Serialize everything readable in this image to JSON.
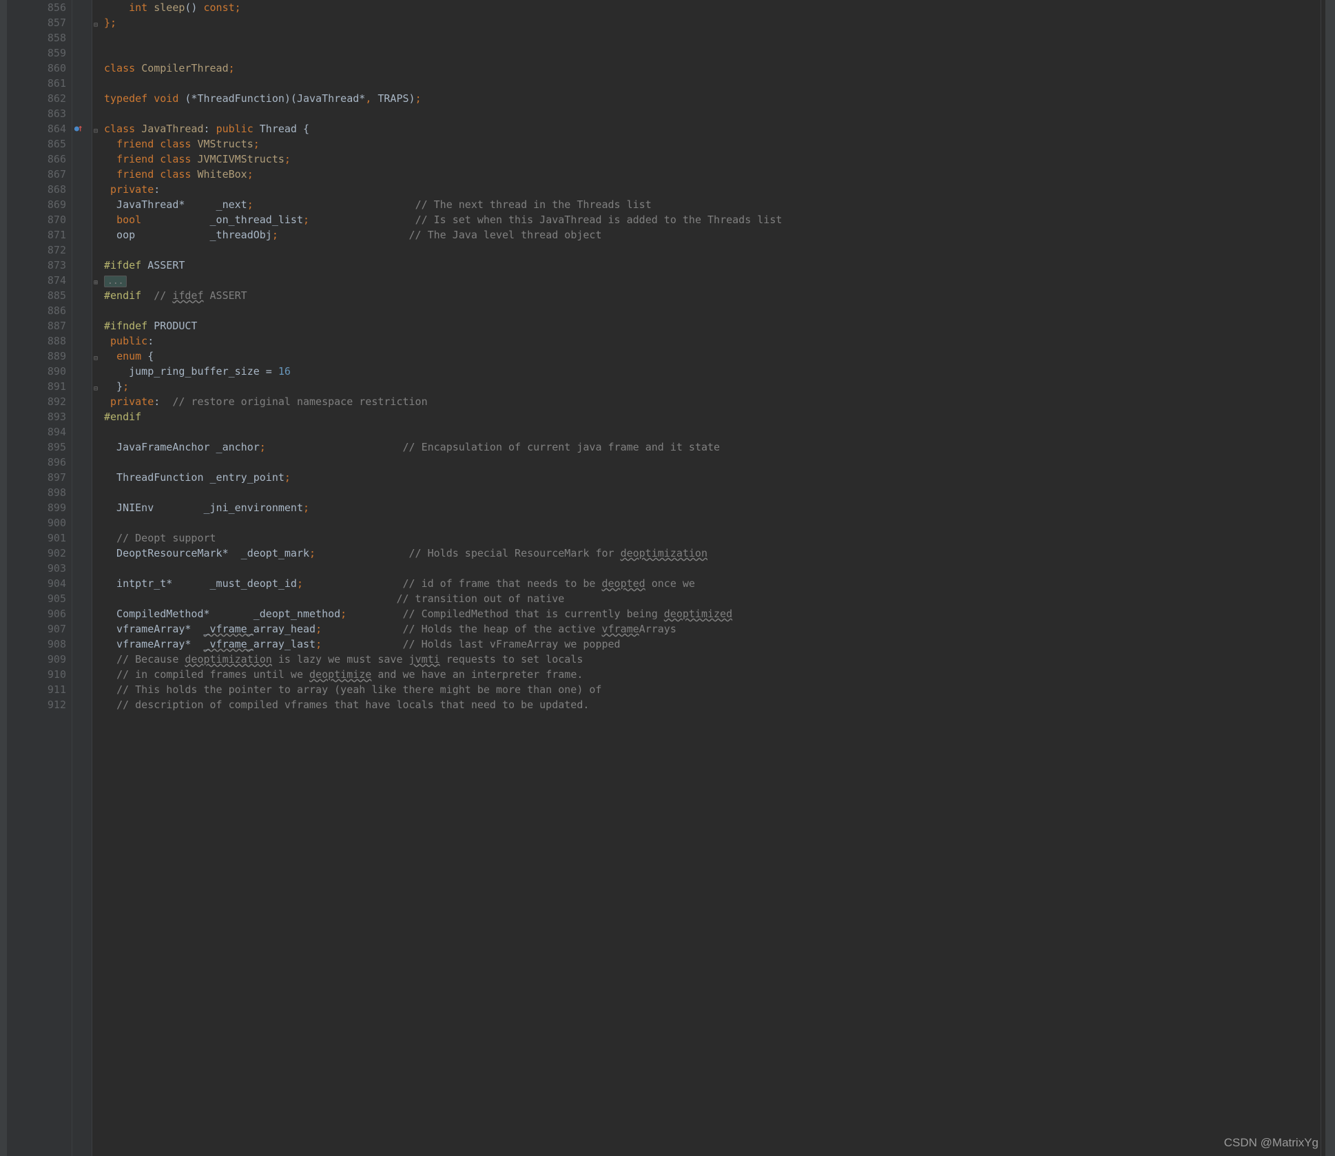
{
  "watermark": "CSDN @MatrixYg",
  "lines": [
    {
      "n": "856",
      "tokens": [
        {
          "t": "    ",
          "c": ""
        },
        {
          "t": "int",
          "c": "kw"
        },
        {
          "t": " ",
          "c": ""
        },
        {
          "t": "sleep",
          "c": "type"
        },
        {
          "t": "() ",
          "c": ""
        },
        {
          "t": "const",
          "c": "kw"
        },
        {
          "t": ";",
          "c": "kw"
        }
      ]
    },
    {
      "n": "857",
      "tokens": [
        {
          "t": "};",
          "c": "kw"
        }
      ],
      "fold": "⊟"
    },
    {
      "n": "858",
      "tokens": []
    },
    {
      "n": "859",
      "tokens": []
    },
    {
      "n": "860",
      "tokens": [
        {
          "t": "class",
          "c": "kw"
        },
        {
          "t": " ",
          "c": ""
        },
        {
          "t": "CompilerThread",
          "c": "type"
        },
        {
          "t": ";",
          "c": "kw"
        }
      ]
    },
    {
      "n": "861",
      "tokens": []
    },
    {
      "n": "862",
      "tokens": [
        {
          "t": "typedef",
          "c": "kw"
        },
        {
          "t": " ",
          "c": ""
        },
        {
          "t": "void",
          "c": "kw"
        },
        {
          "t": " (*ThreadFunction)(JavaThread*",
          "c": ""
        },
        {
          "t": ",",
          "c": "kw"
        },
        {
          "t": " TRAPS)",
          "c": ""
        },
        {
          "t": ";",
          "c": "kw"
        }
      ]
    },
    {
      "n": "863",
      "tokens": []
    },
    {
      "n": "864",
      "tokens": [
        {
          "t": "class",
          "c": "kw"
        },
        {
          "t": " ",
          "c": ""
        },
        {
          "t": "JavaThread",
          "c": "type"
        },
        {
          "t": ": ",
          "c": ""
        },
        {
          "t": "public",
          "c": "kw"
        },
        {
          "t": " Thread {",
          "c": ""
        }
      ],
      "fold": "⊟",
      "marker": "override"
    },
    {
      "n": "865",
      "tokens": [
        {
          "t": "  ",
          "c": ""
        },
        {
          "t": "friend",
          "c": "kw"
        },
        {
          "t": " ",
          "c": ""
        },
        {
          "t": "class",
          "c": "kw"
        },
        {
          "t": " ",
          "c": ""
        },
        {
          "t": "VMStructs",
          "c": "type"
        },
        {
          "t": ";",
          "c": "kw"
        }
      ]
    },
    {
      "n": "866",
      "tokens": [
        {
          "t": "  ",
          "c": ""
        },
        {
          "t": "friend",
          "c": "kw"
        },
        {
          "t": " ",
          "c": ""
        },
        {
          "t": "class",
          "c": "kw"
        },
        {
          "t": " ",
          "c": ""
        },
        {
          "t": "JVMCIVMStructs",
          "c": "type"
        },
        {
          "t": ";",
          "c": "kw"
        }
      ]
    },
    {
      "n": "867",
      "tokens": [
        {
          "t": "  ",
          "c": ""
        },
        {
          "t": "friend",
          "c": "kw"
        },
        {
          "t": " ",
          "c": ""
        },
        {
          "t": "class",
          "c": "kw"
        },
        {
          "t": " ",
          "c": ""
        },
        {
          "t": "WhiteBox",
          "c": "type"
        },
        {
          "t": ";",
          "c": "kw"
        }
      ]
    },
    {
      "n": "868",
      "tokens": [
        {
          "t": " ",
          "c": ""
        },
        {
          "t": "private",
          "c": "kw"
        },
        {
          "t": ":",
          "c": ""
        }
      ]
    },
    {
      "n": "869",
      "tokens": [
        {
          "t": "  JavaThread*     _next",
          "c": ""
        },
        {
          "t": ";",
          "c": "kw"
        },
        {
          "t": "                          ",
          "c": ""
        },
        {
          "t": "// The next thread in the Threads list",
          "c": "comment"
        }
      ]
    },
    {
      "n": "870",
      "tokens": [
        {
          "t": "  ",
          "c": ""
        },
        {
          "t": "bool",
          "c": "kw"
        },
        {
          "t": "           _on_thread_list",
          "c": ""
        },
        {
          "t": ";",
          "c": "kw"
        },
        {
          "t": "                 ",
          "c": ""
        },
        {
          "t": "// Is set when this JavaThread is added to the Threads list",
          "c": "comment"
        }
      ]
    },
    {
      "n": "871",
      "tokens": [
        {
          "t": "  oop            _threadObj",
          "c": ""
        },
        {
          "t": ";",
          "c": "kw"
        },
        {
          "t": "                     ",
          "c": ""
        },
        {
          "t": "// The Java level thread object",
          "c": "comment"
        }
      ]
    },
    {
      "n": "872",
      "tokens": []
    },
    {
      "n": "873",
      "tokens": [
        {
          "t": "#ifdef",
          "c": "preproc"
        },
        {
          "t": " ASSERT",
          "c": ""
        }
      ]
    },
    {
      "n": "874",
      "folded": "...",
      "fold": "⊞"
    },
    {
      "n": "885",
      "tokens": [
        {
          "t": "#endif",
          "c": "preproc"
        },
        {
          "t": "  ",
          "c": ""
        },
        {
          "t": "// ",
          "c": "comment"
        },
        {
          "t": "ifdef",
          "c": "comment underline"
        },
        {
          "t": " ASSERT",
          "c": "comment"
        }
      ]
    },
    {
      "n": "886",
      "tokens": []
    },
    {
      "n": "887",
      "tokens": [
        {
          "t": "#ifndef",
          "c": "preproc"
        },
        {
          "t": " PRODUCT",
          "c": ""
        }
      ]
    },
    {
      "n": "888",
      "tokens": [
        {
          "t": " ",
          "c": ""
        },
        {
          "t": "public",
          "c": "kw"
        },
        {
          "t": ":",
          "c": ""
        }
      ]
    },
    {
      "n": "889",
      "tokens": [
        {
          "t": "  ",
          "c": ""
        },
        {
          "t": "enum",
          "c": "kw"
        },
        {
          "t": " {",
          "c": ""
        }
      ],
      "fold": "⊟"
    },
    {
      "n": "890",
      "tokens": [
        {
          "t": "    jump_ring_buffer_size = ",
          "c": ""
        },
        {
          "t": "16",
          "c": "num"
        }
      ]
    },
    {
      "n": "891",
      "tokens": [
        {
          "t": "  }",
          "c": ""
        },
        {
          "t": ";",
          "c": "kw"
        }
      ],
      "fold": "⊟"
    },
    {
      "n": "892",
      "tokens": [
        {
          "t": " ",
          "c": ""
        },
        {
          "t": "private",
          "c": "kw"
        },
        {
          "t": ":  ",
          "c": ""
        },
        {
          "t": "// restore original namespace restriction",
          "c": "comment"
        }
      ]
    },
    {
      "n": "893",
      "tokens": [
        {
          "t": "#endif",
          "c": "preproc"
        }
      ]
    },
    {
      "n": "894",
      "tokens": []
    },
    {
      "n": "895",
      "tokens": [
        {
          "t": "  JavaFrameAnchor _anchor",
          "c": ""
        },
        {
          "t": ";",
          "c": "kw"
        },
        {
          "t": "                      ",
          "c": ""
        },
        {
          "t": "// Encapsulation of current java frame and it state",
          "c": "comment"
        }
      ]
    },
    {
      "n": "896",
      "tokens": []
    },
    {
      "n": "897",
      "tokens": [
        {
          "t": "  ThreadFunction _entry_point",
          "c": ""
        },
        {
          "t": ";",
          "c": "kw"
        }
      ]
    },
    {
      "n": "898",
      "tokens": []
    },
    {
      "n": "899",
      "tokens": [
        {
          "t": "  JNIEnv        _jni_environment",
          "c": ""
        },
        {
          "t": ";",
          "c": "kw"
        }
      ]
    },
    {
      "n": "900",
      "tokens": []
    },
    {
      "n": "901",
      "tokens": [
        {
          "t": "  ",
          "c": ""
        },
        {
          "t": "// Deopt support",
          "c": "comment"
        }
      ]
    },
    {
      "n": "902",
      "tokens": [
        {
          "t": "  DeoptResourceMark*  _deopt_mark",
          "c": ""
        },
        {
          "t": ";",
          "c": "kw"
        },
        {
          "t": "               ",
          "c": ""
        },
        {
          "t": "// Holds special ResourceMark for ",
          "c": "comment"
        },
        {
          "t": "deoptimization",
          "c": "comment underline"
        }
      ]
    },
    {
      "n": "903",
      "tokens": []
    },
    {
      "n": "904",
      "tokens": [
        {
          "t": "  intptr_t*      _must_deopt_id",
          "c": ""
        },
        {
          "t": ";",
          "c": "kw"
        },
        {
          "t": "                ",
          "c": ""
        },
        {
          "t": "// id of frame that needs to be ",
          "c": "comment"
        },
        {
          "t": "deopted",
          "c": "comment underline"
        },
        {
          "t": " once we",
          "c": "comment"
        }
      ]
    },
    {
      "n": "905",
      "tokens": [
        {
          "t": "                                               ",
          "c": ""
        },
        {
          "t": "// transition out of native",
          "c": "comment"
        }
      ]
    },
    {
      "n": "906",
      "tokens": [
        {
          "t": "  CompiledMethod*       _deopt_nmethod",
          "c": ""
        },
        {
          "t": ";",
          "c": "kw"
        },
        {
          "t": "         ",
          "c": ""
        },
        {
          "t": "// CompiledMethod that is currently being ",
          "c": "comment"
        },
        {
          "t": "deoptimized",
          "c": "comment underline"
        }
      ]
    },
    {
      "n": "907",
      "tokens": [
        {
          "t": "  vframeArray*  ",
          "c": ""
        },
        {
          "t": "_vframe_",
          "c": "underline"
        },
        {
          "t": "array_head",
          "c": ""
        },
        {
          "t": ";",
          "c": "kw"
        },
        {
          "t": "             ",
          "c": ""
        },
        {
          "t": "// Holds the heap of the active ",
          "c": "comment"
        },
        {
          "t": "vframe",
          "c": "comment underline"
        },
        {
          "t": "Arrays",
          "c": "comment"
        }
      ]
    },
    {
      "n": "908",
      "tokens": [
        {
          "t": "  vframeArray*  ",
          "c": ""
        },
        {
          "t": "_vframe_",
          "c": "underline"
        },
        {
          "t": "array_last",
          "c": ""
        },
        {
          "t": ";",
          "c": "kw"
        },
        {
          "t": "             ",
          "c": ""
        },
        {
          "t": "// Holds last vFrameArray we popped",
          "c": "comment"
        }
      ]
    },
    {
      "n": "909",
      "tokens": [
        {
          "t": "  ",
          "c": ""
        },
        {
          "t": "// Because ",
          "c": "comment"
        },
        {
          "t": "deoptimization",
          "c": "comment underline"
        },
        {
          "t": " is lazy we must save ",
          "c": "comment"
        },
        {
          "t": "jvmti",
          "c": "comment underline"
        },
        {
          "t": " requests to set locals",
          "c": "comment"
        }
      ]
    },
    {
      "n": "910",
      "tokens": [
        {
          "t": "  ",
          "c": ""
        },
        {
          "t": "// in compiled frames until we ",
          "c": "comment"
        },
        {
          "t": "deoptimize",
          "c": "comment underline"
        },
        {
          "t": " and we have an interpreter frame.",
          "c": "comment"
        }
      ]
    },
    {
      "n": "911",
      "tokens": [
        {
          "t": "  ",
          "c": ""
        },
        {
          "t": "// This holds the pointer to array (yeah like there might be more than one) of",
          "c": "comment"
        }
      ]
    },
    {
      "n": "912",
      "tokens": [
        {
          "t": "  ",
          "c": ""
        },
        {
          "t": "// description of compiled vframes that have locals that need to be updated.",
          "c": "comment"
        }
      ]
    }
  ]
}
